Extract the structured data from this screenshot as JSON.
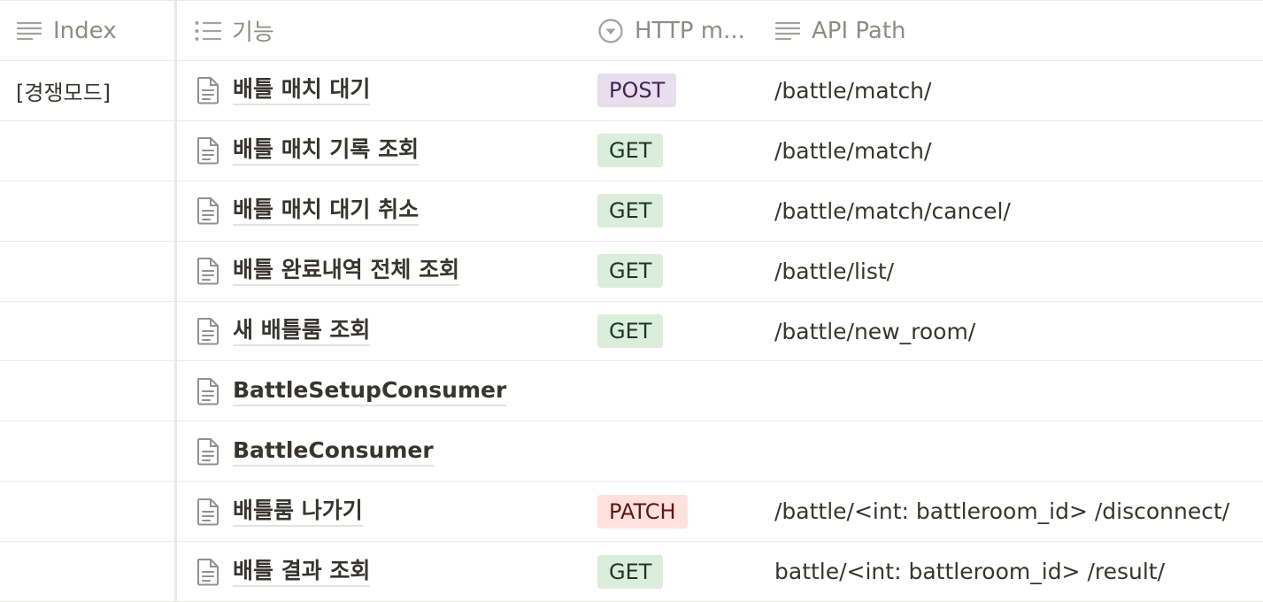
{
  "columns": {
    "index": "Index",
    "name": "기능",
    "method": "HTTP m...",
    "path": "API Path"
  },
  "method_colors": {
    "POST": {
      "bg": "#e8deee",
      "fg": "#412454"
    },
    "GET": {
      "bg": "#dbeddb",
      "fg": "#1c3829"
    },
    "PATCH": {
      "bg": "#ffe2dd",
      "fg": "#5d1715"
    }
  },
  "rows": [
    {
      "index": "[경쟁모드]",
      "name": "배틀 매치 대기",
      "method": "POST",
      "path": "/battle/match/"
    },
    {
      "index": "",
      "name": "배틀 매치 기록 조회",
      "method": "GET",
      "path": "/battle/match/"
    },
    {
      "index": "",
      "name": "배틀 매치 대기 취소",
      "method": "GET",
      "path": "/battle/match/cancel/"
    },
    {
      "index": "",
      "name": "배틀 완료내역 전체 조회",
      "method": "GET",
      "path": "/battle/list/"
    },
    {
      "index": "",
      "name": "새 배틀룸 조회",
      "method": "GET",
      "path": "/battle/new_room/"
    },
    {
      "index": "",
      "name": "BattleSetupConsumer",
      "method": "",
      "path": ""
    },
    {
      "index": "",
      "name": "BattleConsumer",
      "method": "",
      "path": ""
    },
    {
      "index": "",
      "name": "배틀룸 나가기",
      "method": "PATCH",
      "path": "/battle/<int: battleroom_id> /disconnect/"
    },
    {
      "index": "",
      "name": "배틀 결과 조회",
      "method": "GET",
      "path": "battle/<int: battleroom_id> /result/"
    }
  ]
}
